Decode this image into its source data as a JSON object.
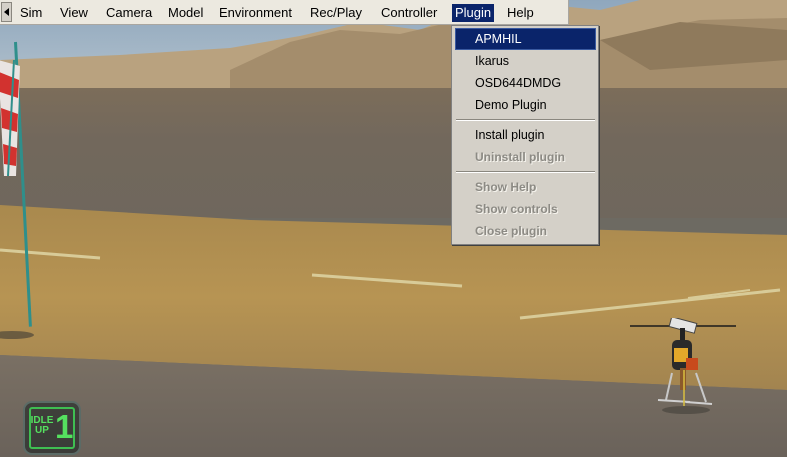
{
  "menubar": {
    "items": [
      "Sim",
      "View",
      "Camera",
      "Model",
      "Environment",
      "Rec/Play",
      "Controller",
      "Plugin",
      "Help"
    ],
    "active": "Plugin"
  },
  "plugin_menu": {
    "plugins": [
      "APMHIL",
      "Ikarus",
      "OSD644DMDG",
      "Demo Plugin"
    ],
    "selected": "APMHIL",
    "install": "Install plugin",
    "uninstall": "Uninstall plugin",
    "show_help": "Show Help",
    "show_controls": "Show controls",
    "close": "Close plugin"
  },
  "hud": {
    "flight_mode_line1": "IDLE",
    "flight_mode_line2": "UP",
    "flight_mode_number": "1",
    "mode_color": "#55e05f"
  },
  "scene": {
    "windsock": "windsock-icon",
    "aircraft": "helicopter-icon"
  }
}
